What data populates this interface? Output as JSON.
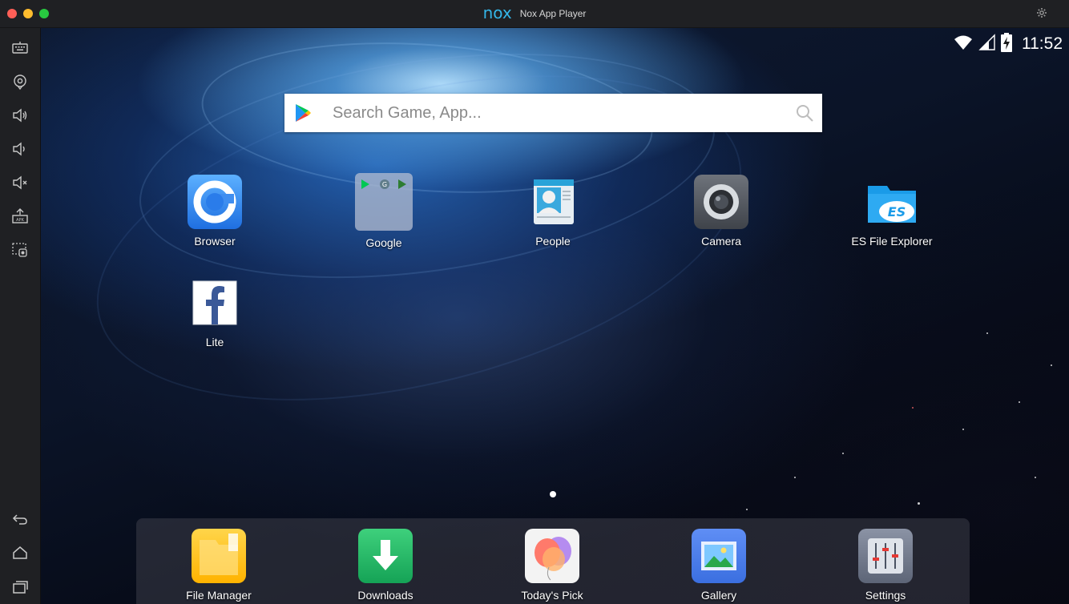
{
  "window": {
    "logo_text": "nox",
    "title": "Nox App Player"
  },
  "sidebar": {
    "items": [
      {
        "name": "keyboard-icon"
      },
      {
        "name": "location-icon"
      },
      {
        "name": "volume-up-icon"
      },
      {
        "name": "volume-down-icon"
      },
      {
        "name": "mute-icon"
      },
      {
        "name": "apk-install-icon"
      },
      {
        "name": "screen-record-icon"
      },
      {
        "name": "back-icon"
      },
      {
        "name": "home-icon"
      },
      {
        "name": "recent-apps-icon"
      }
    ]
  },
  "status": {
    "time": "11:52"
  },
  "search": {
    "placeholder": "Search Game, App..."
  },
  "home_apps": [
    {
      "label": "Browser"
    },
    {
      "label": "Google"
    },
    {
      "label": "People"
    },
    {
      "label": "Camera"
    },
    {
      "label": "ES File Explorer"
    },
    {
      "label": "Lite"
    }
  ],
  "dock_apps": [
    {
      "label": "File Manager"
    },
    {
      "label": "Downloads"
    },
    {
      "label": "Today's Pick"
    },
    {
      "label": "Gallery"
    },
    {
      "label": "Settings"
    }
  ],
  "colors": {
    "nox_blue": "#34b6e9",
    "title_bar": "#1f2023",
    "wallpaper_glow": "#8fd0ff"
  }
}
